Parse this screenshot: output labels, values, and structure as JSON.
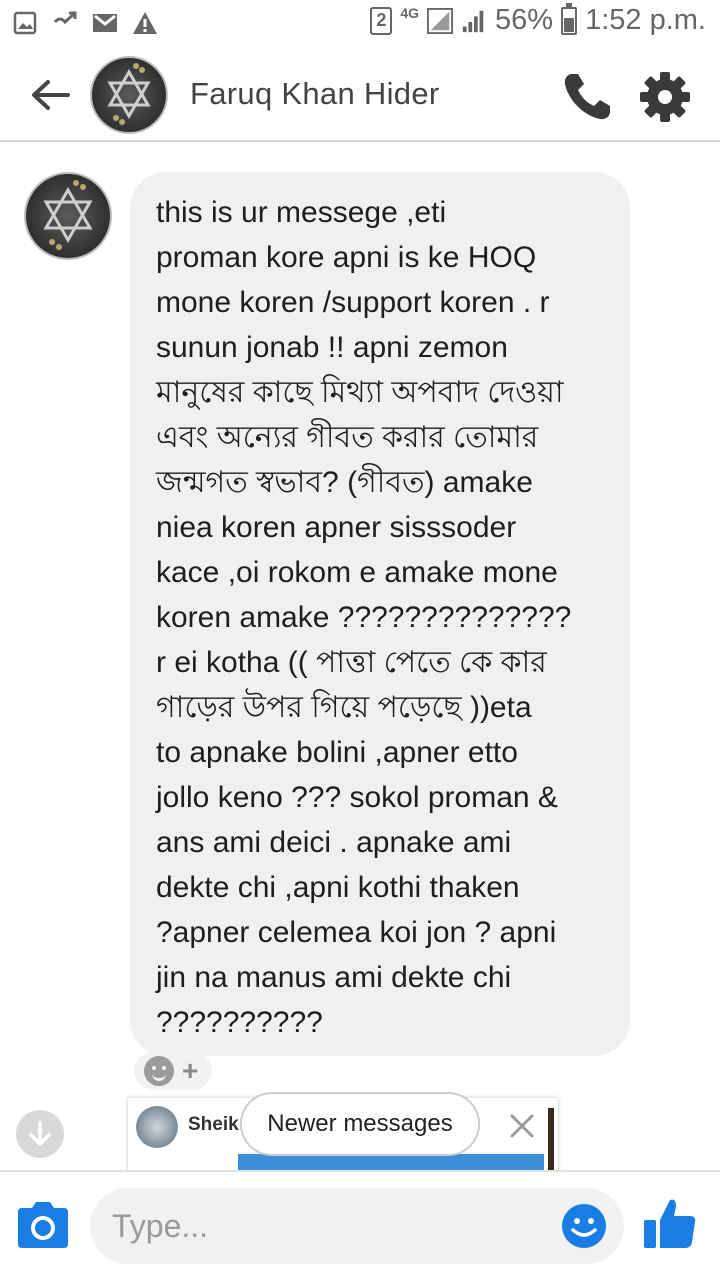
{
  "status_bar": {
    "sim_slot": "2",
    "network": "4G",
    "battery_percent": "56%",
    "time": "1:52 p.m."
  },
  "header": {
    "contact_name": "Faruq Khan Hider"
  },
  "message": {
    "text": "this is ur messege ,eti\nproman kore apni is ke HOQ\nmone koren /support koren . r\nsunun jonab !! apni zemon\nমানুষের কাছে মিথ্যা অপবাদ দেওয়া\nএবং অন্যের গীবত করার তোমার\nজন্মগত স্বভাব?  (গীবত) amake\nniea koren apner sisssoder\nkace ,oi rokom e amake mone\nkoren amake ??????????????\nr ei kotha (( পাত্তা পেতে কে কার\nগাড়ের উপর গিয়ে     পড়েছে ))eta\nto apnake bolini ,apner etto\njollo keno ??? sokol proman &\nans ami deici   . apnake ami\ndekte chi ,apni kothi thaken\n?apner celemea koi jon ? apni\njin na manus ami dekte chi\n??????????"
  },
  "shared_card": {
    "name": "Sheik"
  },
  "newer_messages": {
    "label": "Newer messages"
  },
  "composer": {
    "placeholder": "Type..."
  },
  "colors": {
    "accent": "#1a7de3",
    "bubble": "#f1f0f0"
  },
  "icons": {
    "back": "arrow-left-icon",
    "call": "phone-icon",
    "settings": "gear-icon",
    "camera": "camera-icon",
    "emoji": "smile-icon",
    "like": "thumbs-up-icon",
    "scroll_down": "arrow-down-icon",
    "close": "close-icon"
  }
}
